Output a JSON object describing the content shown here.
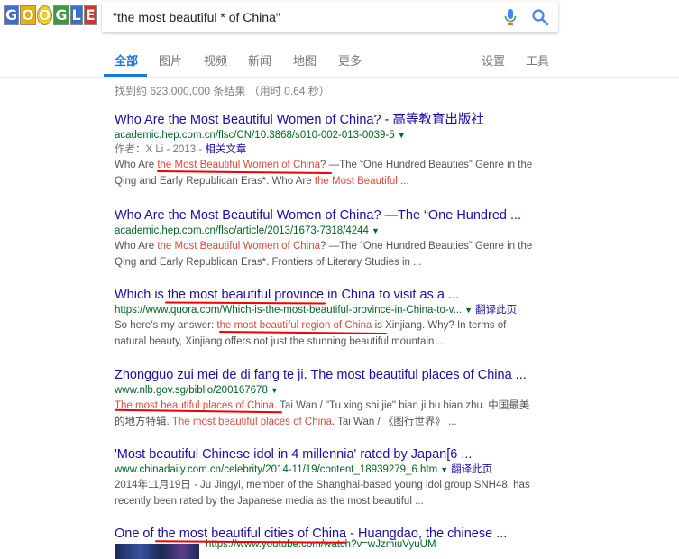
{
  "logo": {
    "letters": [
      "G",
      "O",
      "O",
      "G",
      "L",
      "E"
    ]
  },
  "search": {
    "query": "\"the most beautiful * of China\""
  },
  "tabs": [
    {
      "label": "全部",
      "active": true
    },
    {
      "label": "图片"
    },
    {
      "label": "视频"
    },
    {
      "label": "新闻"
    },
    {
      "label": "地图"
    },
    {
      "label": "更多"
    }
  ],
  "settings_label": "设置",
  "tools_label": "工具",
  "stats": "找到约 623,000,000 条结果 （用时 0.64 秒）",
  "results": [
    {
      "title": "Who Are the Most Beautiful Women of China? - 高等教育出版社",
      "url": "academic.hep.com.cn/flsc/CN/10.3868/s010-002-013-0039-5",
      "meta_prefix": "作者：X Li - 2013 - ",
      "meta_link": "相关文章",
      "snippet": [
        {
          "t": "Who Are "
        },
        {
          "t": "the Most Beautiful Women of China",
          "em": true
        },
        {
          "t": "? —The “One Hundred Beauties” Genre in the Qing and Early Republican Eras*. Who Are "
        },
        {
          "t": "the Most Beautiful",
          "em": true
        },
        {
          "t": " ..."
        }
      ]
    },
    {
      "title": "Who Are the Most Beautiful Women of China? —The “One Hundred ...",
      "url": "academic.hep.com.cn/flsc/article/2013/1673-7318/4244",
      "snippet": [
        {
          "t": "Who Are "
        },
        {
          "t": "the Most Beautiful Women of China",
          "em": true
        },
        {
          "t": "? —The “One Hundred Beauties” Genre in the Qing and Early Republican Eras*. Frontiers of Literary Studies in ..."
        }
      ]
    },
    {
      "title": "Which is the most beautiful province in China to visit as a ...",
      "url": "https://www.quora.com/Which-is-the-most-beautiful-province-in-China-to-v...",
      "translate": "翻译此页",
      "snippet": [
        {
          "t": "So here's my answer: "
        },
        {
          "t": "the most beautiful region of China",
          "em": true
        },
        {
          "t": " is Xinjiang. Why? In terms of natural beauty, Xinjiang offers not just the stunning beautiful mountain ..."
        }
      ]
    },
    {
      "title": "Zhongguo zui mei de di fang te ji. The most beautiful places of China ...",
      "url": "www.nlb.gov.sg/biblio/200167678",
      "snippet": [
        {
          "t": "The most beautiful places of China",
          "em": true
        },
        {
          "t": ". Tai Wan / \"Tu xing shi jie\" bian ji bu bian zhu. 中国最美的地方特辑. "
        },
        {
          "t": "The most beautiful places of China",
          "em": true
        },
        {
          "t": ". Tai Wan / 《图行世界》 ..."
        }
      ]
    },
    {
      "title": "'Most beautiful Chinese idol in 4 millennia' rated by Japan[6 ...",
      "url": "www.chinadaily.com.cn/celebrity/2014-11/19/content_18939279_6.htm",
      "translate": "翻译此页",
      "snippet": [
        {
          "t": "2014年11月19日 - Ju Jingyi, member of the Shanghai-based young idol group SNH48, has recently been rated by the Japanese media as the most beautiful ..."
        }
      ]
    },
    {
      "title": "One of the most beautiful cities of China - Huangdao, the chinese ...",
      "url": "https://www.youtube.com/watch?v=wJzmiuVyuUM"
    }
  ]
}
